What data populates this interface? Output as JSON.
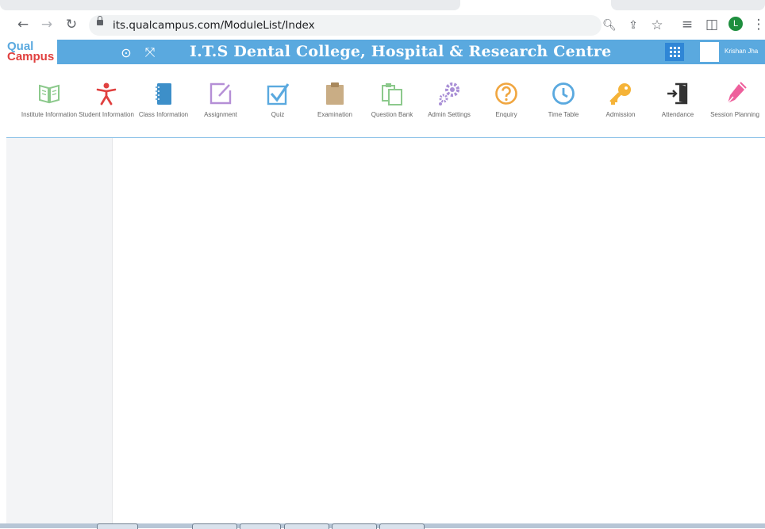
{
  "browser": {
    "url": "its.qualcampus.com/ModuleList/Index",
    "profile_initial": "L"
  },
  "header": {
    "logo_top": "Qual",
    "logo_bottom": "Campus",
    "title": "I.T.S Dental College, Hospital & Research Centre",
    "user_name": "Krishan Jha"
  },
  "modules": [
    {
      "label": "Institute Information",
      "icon": "open-book-icon",
      "color": "#8cc98c"
    },
    {
      "label": "Student Information",
      "icon": "person-icon",
      "color": "#e0403f"
    },
    {
      "label": "Class Information",
      "icon": "notebook-icon",
      "color": "#3d8fc9"
    },
    {
      "label": "Assignment",
      "icon": "edit-icon",
      "color": "#b58fd6"
    },
    {
      "label": "Quiz",
      "icon": "checkbox-icon",
      "color": "#5aa9df"
    },
    {
      "label": "Examination",
      "icon": "clipboard-icon",
      "color": "#c9ad85"
    },
    {
      "label": "Question Bank",
      "icon": "copy-clipboard-icon",
      "color": "#8cc98c"
    },
    {
      "label": "Admin Settings",
      "icon": "gears-icon",
      "color": "#a98fd6"
    },
    {
      "label": "Enquiry",
      "icon": "question-icon",
      "color": "#f0a640"
    },
    {
      "label": "Time Table",
      "icon": "clock-icon",
      "color": "#5aa9df"
    },
    {
      "label": "Admission",
      "icon": "key-icon",
      "color": "#f5b338"
    },
    {
      "label": "Attendance",
      "icon": "sign-in-icon",
      "color": "#333333"
    },
    {
      "label": "Session Planning",
      "icon": "pen-icon",
      "color": "#ee5f9c"
    }
  ]
}
